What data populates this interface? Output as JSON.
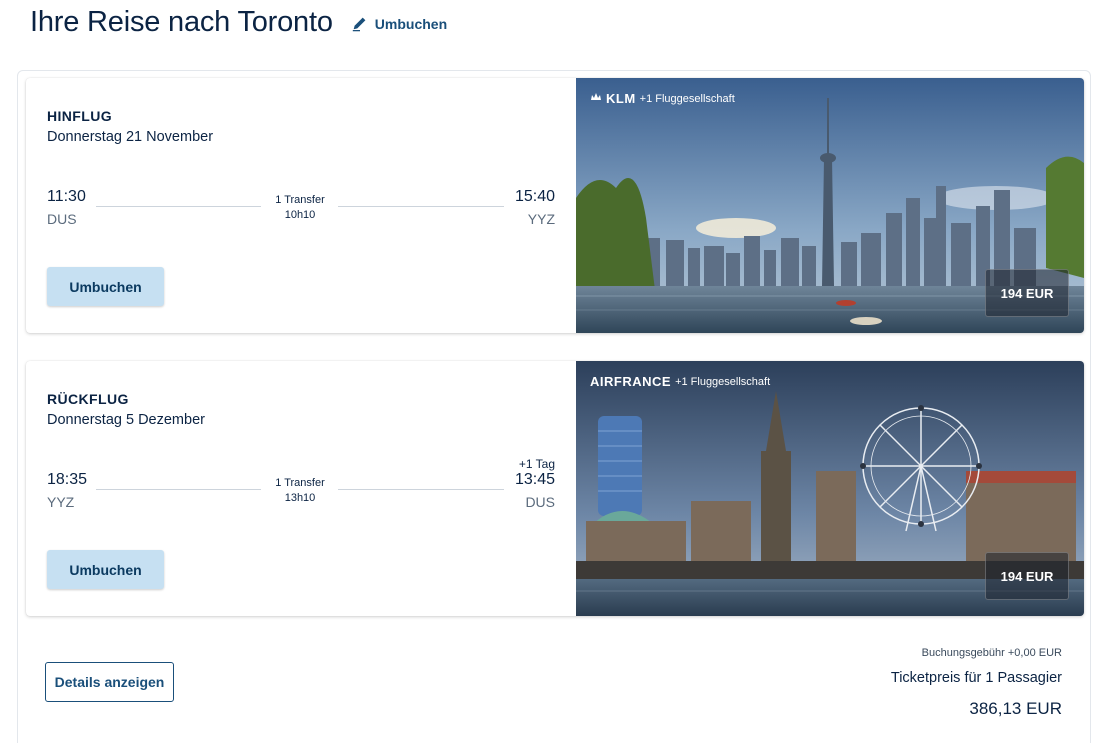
{
  "header": {
    "title": "Ihre Reise nach Toronto",
    "rebook_label": "Umbuchen"
  },
  "outbound": {
    "direction": "HINFLUG",
    "date": "Donnerstag 21 November",
    "dep_time": "11:30",
    "dep_code": "DUS",
    "arr_time": "15:40",
    "arr_code": "YYZ",
    "transfer": "1 Transfer",
    "duration": "10h10",
    "rebook_label": "Umbuchen",
    "airline_brand": "KLM",
    "airline_extra": "+1 Fluggesellschaft",
    "price": "194 EUR"
  },
  "return": {
    "direction": "RÜCKFLUG",
    "date": "Donnerstag 5 Dezember",
    "dep_time": "18:35",
    "dep_code": "YYZ",
    "arr_time": "13:45",
    "arr_code": "DUS",
    "plus_day": "+1 Tag",
    "transfer": "1 Transfer",
    "duration": "13h10",
    "rebook_label": "Umbuchen",
    "airline_brand": "AIRFRANCE",
    "airline_extra": "+1 Fluggesellschaft",
    "price": "194 EUR"
  },
  "footer": {
    "details_label": "Details anzeigen",
    "booking_fee": "Buchungsgebühr +0,00 EUR",
    "ticket_label": "Ticketpreis für 1 Passagier",
    "total": "386,13 EUR"
  },
  "colors": {
    "primary_text": "#0b2343",
    "accent": "#1a4f7a",
    "button_bg": "#c6e0f2"
  }
}
